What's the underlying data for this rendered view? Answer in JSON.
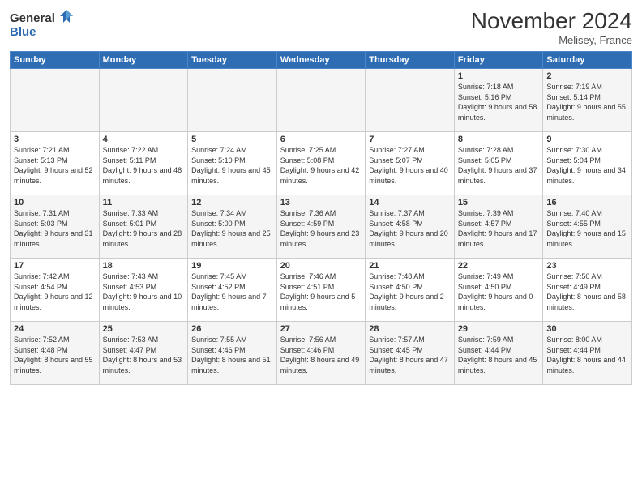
{
  "logo": {
    "general": "General",
    "blue": "Blue"
  },
  "header": {
    "title": "November 2024",
    "location": "Melisey, France"
  },
  "weekdays": [
    "Sunday",
    "Monday",
    "Tuesday",
    "Wednesday",
    "Thursday",
    "Friday",
    "Saturday"
  ],
  "weeks": [
    [
      {
        "day": "",
        "info": ""
      },
      {
        "day": "",
        "info": ""
      },
      {
        "day": "",
        "info": ""
      },
      {
        "day": "",
        "info": ""
      },
      {
        "day": "",
        "info": ""
      },
      {
        "day": "1",
        "info": "Sunrise: 7:18 AM\nSunset: 5:16 PM\nDaylight: 9 hours and 58 minutes."
      },
      {
        "day": "2",
        "info": "Sunrise: 7:19 AM\nSunset: 5:14 PM\nDaylight: 9 hours and 55 minutes."
      }
    ],
    [
      {
        "day": "3",
        "info": "Sunrise: 7:21 AM\nSunset: 5:13 PM\nDaylight: 9 hours and 52 minutes."
      },
      {
        "day": "4",
        "info": "Sunrise: 7:22 AM\nSunset: 5:11 PM\nDaylight: 9 hours and 48 minutes."
      },
      {
        "day": "5",
        "info": "Sunrise: 7:24 AM\nSunset: 5:10 PM\nDaylight: 9 hours and 45 minutes."
      },
      {
        "day": "6",
        "info": "Sunrise: 7:25 AM\nSunset: 5:08 PM\nDaylight: 9 hours and 42 minutes."
      },
      {
        "day": "7",
        "info": "Sunrise: 7:27 AM\nSunset: 5:07 PM\nDaylight: 9 hours and 40 minutes."
      },
      {
        "day": "8",
        "info": "Sunrise: 7:28 AM\nSunset: 5:05 PM\nDaylight: 9 hours and 37 minutes."
      },
      {
        "day": "9",
        "info": "Sunrise: 7:30 AM\nSunset: 5:04 PM\nDaylight: 9 hours and 34 minutes."
      }
    ],
    [
      {
        "day": "10",
        "info": "Sunrise: 7:31 AM\nSunset: 5:03 PM\nDaylight: 9 hours and 31 minutes."
      },
      {
        "day": "11",
        "info": "Sunrise: 7:33 AM\nSunset: 5:01 PM\nDaylight: 9 hours and 28 minutes."
      },
      {
        "day": "12",
        "info": "Sunrise: 7:34 AM\nSunset: 5:00 PM\nDaylight: 9 hours and 25 minutes."
      },
      {
        "day": "13",
        "info": "Sunrise: 7:36 AM\nSunset: 4:59 PM\nDaylight: 9 hours and 23 minutes."
      },
      {
        "day": "14",
        "info": "Sunrise: 7:37 AM\nSunset: 4:58 PM\nDaylight: 9 hours and 20 minutes."
      },
      {
        "day": "15",
        "info": "Sunrise: 7:39 AM\nSunset: 4:57 PM\nDaylight: 9 hours and 17 minutes."
      },
      {
        "day": "16",
        "info": "Sunrise: 7:40 AM\nSunset: 4:55 PM\nDaylight: 9 hours and 15 minutes."
      }
    ],
    [
      {
        "day": "17",
        "info": "Sunrise: 7:42 AM\nSunset: 4:54 PM\nDaylight: 9 hours and 12 minutes."
      },
      {
        "day": "18",
        "info": "Sunrise: 7:43 AM\nSunset: 4:53 PM\nDaylight: 9 hours and 10 minutes."
      },
      {
        "day": "19",
        "info": "Sunrise: 7:45 AM\nSunset: 4:52 PM\nDaylight: 9 hours and 7 minutes."
      },
      {
        "day": "20",
        "info": "Sunrise: 7:46 AM\nSunset: 4:51 PM\nDaylight: 9 hours and 5 minutes."
      },
      {
        "day": "21",
        "info": "Sunrise: 7:48 AM\nSunset: 4:50 PM\nDaylight: 9 hours and 2 minutes."
      },
      {
        "day": "22",
        "info": "Sunrise: 7:49 AM\nSunset: 4:50 PM\nDaylight: 9 hours and 0 minutes."
      },
      {
        "day": "23",
        "info": "Sunrise: 7:50 AM\nSunset: 4:49 PM\nDaylight: 8 hours and 58 minutes."
      }
    ],
    [
      {
        "day": "24",
        "info": "Sunrise: 7:52 AM\nSunset: 4:48 PM\nDaylight: 8 hours and 55 minutes."
      },
      {
        "day": "25",
        "info": "Sunrise: 7:53 AM\nSunset: 4:47 PM\nDaylight: 8 hours and 53 minutes."
      },
      {
        "day": "26",
        "info": "Sunrise: 7:55 AM\nSunset: 4:46 PM\nDaylight: 8 hours and 51 minutes."
      },
      {
        "day": "27",
        "info": "Sunrise: 7:56 AM\nSunset: 4:46 PM\nDaylight: 8 hours and 49 minutes."
      },
      {
        "day": "28",
        "info": "Sunrise: 7:57 AM\nSunset: 4:45 PM\nDaylight: 8 hours and 47 minutes."
      },
      {
        "day": "29",
        "info": "Sunrise: 7:59 AM\nSunset: 4:44 PM\nDaylight: 8 hours and 45 minutes."
      },
      {
        "day": "30",
        "info": "Sunrise: 8:00 AM\nSunset: 4:44 PM\nDaylight: 8 hours and 44 minutes."
      }
    ]
  ]
}
